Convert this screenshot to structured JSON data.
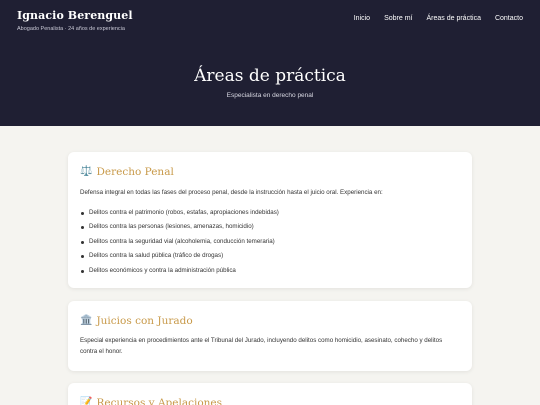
{
  "brand": {
    "name": "Ignacio Berenguel",
    "tagline": "Abogado Penalista · 24 años de experiencia"
  },
  "nav": {
    "items": [
      "Inicio",
      "Sobre mí",
      "Áreas de práctica",
      "Contacto"
    ]
  },
  "hero": {
    "title": "Áreas de práctica",
    "subtitle": "Especialista en derecho penal"
  },
  "cards": [
    {
      "icon": "scales-icon",
      "icon_glyph": "⚖️",
      "title": "Derecho Penal",
      "text": "Defensa integral en todas las fases del proceso penal, desde la instrucción hasta el juicio oral. Experiencia en:",
      "items": [
        "Delitos contra el patrimonio (robos, estafas, apropiaciones indebidas)",
        "Delitos contra las personas (lesiones, amenazas, homicidio)",
        "Delitos contra la seguridad vial (alcoholemia, conducción temeraria)",
        "Delitos contra la salud pública (tráfico de drogas)",
        "Delitos económicos y contra la administración pública"
      ]
    },
    {
      "icon": "courthouse-icon",
      "icon_glyph": "🏛️",
      "title": "Juicios con Jurado",
      "text": "Especial experiencia en procedimientos ante el Tribunal del Jurado, incluyendo delitos como homicidio, asesinato, cohecho y delitos contra el honor."
    },
    {
      "icon": "memo-icon",
      "icon_glyph": "📝",
      "title": "Recursos y Apelaciones"
    }
  ]
}
